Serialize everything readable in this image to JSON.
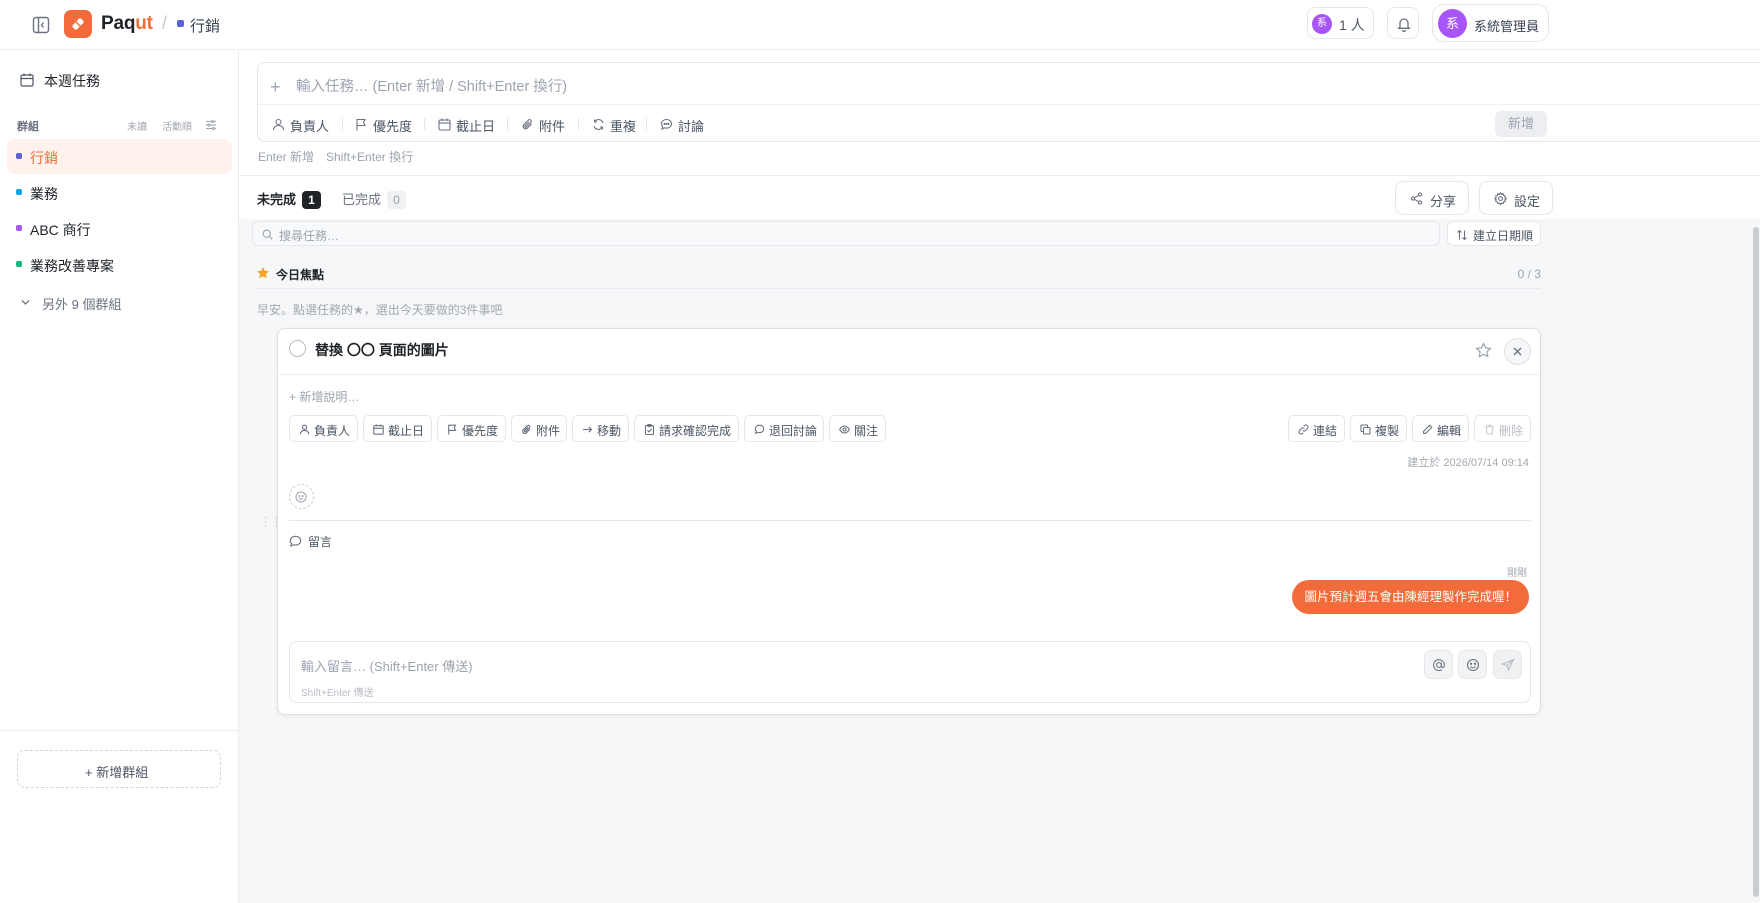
{
  "header": {
    "brand_prefix": "Paq",
    "brand_accent": "ut",
    "breadcrumb_group": "行銷",
    "member_avatar": "系",
    "member_count": "1 人",
    "user_avatar": "系",
    "user_name": "系統管理員",
    "accent_color": "#f26b3a"
  },
  "sidebar": {
    "weekly_tasks": "本週任務",
    "groups_title": "群組",
    "sort_unread": "未讀",
    "sort_activity": "活動順",
    "groups": [
      {
        "label": "行銷",
        "color": "#5b5fd8",
        "active": true
      },
      {
        "label": "業務",
        "color": "#0ea5e9",
        "active": false
      },
      {
        "label": "ABC 商行",
        "color": "#a855f7",
        "active": false
      },
      {
        "label": "業務改善專案",
        "color": "#10b981",
        "active": false
      }
    ],
    "more_groups": "另外 9 個群組",
    "add_group": "+ 新增群組"
  },
  "composer": {
    "placeholder": "輸入任務… (Enter 新增 / Shift+Enter 換行)",
    "options": {
      "assignee": "負責人",
      "priority": "優先度",
      "due_date": "截止日",
      "attachment": "附件",
      "repeat": "重複",
      "discussion": "討論"
    },
    "submit": "新增",
    "hint_enter": "Enter 新增",
    "hint_shift": "Shift+Enter 換行"
  },
  "tabs": {
    "incomplete_label": "未完成",
    "incomplete_count": "1",
    "complete_label": "已完成",
    "complete_count": "0",
    "share": "分享",
    "settings": "設定"
  },
  "list": {
    "search_placeholder": "搜尋任務…",
    "sort_label": "建立日期順",
    "focus_label": "今日焦點",
    "focus_count": "0 / 3",
    "greeting": "早安。點選任務的★，選出今天要做的3件事吧"
  },
  "task": {
    "title": "替換 〇〇 頁面的圖片",
    "add_description": "+ 新增說明…",
    "actions": {
      "assignee": "負責人",
      "due_date": "截止日",
      "priority": "優先度",
      "attachment": "附件",
      "move": "移動",
      "request_confirm": "請求確認完成",
      "return_discussion": "退回討論",
      "watch": "關注",
      "link": "連結",
      "copy": "複製",
      "edit": "編輯",
      "delete": "刪除"
    },
    "created_at": "建立於 2026/07/14 09:14",
    "comments_label": "留言",
    "comments": [
      {
        "time": "剛剛",
        "text": "圖片預計週五會由陳經理製作完成喔！"
      }
    ],
    "comment_placeholder": "輸入留言… (Shift+Enter 傳送)",
    "comment_hint": "Shift+Enter 傳送"
  }
}
